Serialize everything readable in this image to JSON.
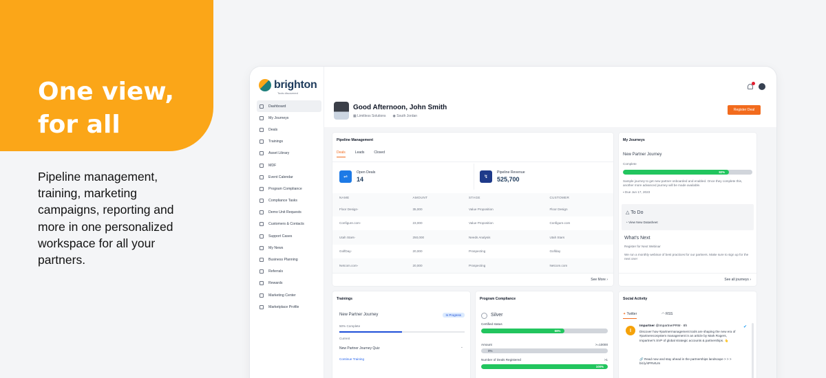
{
  "hero": {
    "title_line1": "One view,",
    "title_line2": "for all",
    "description": "Pipeline management, training, marketing campaigns, reporting and more in one personalized workspace for all your partners."
  },
  "brand": {
    "name": "brighton",
    "tagline": "Tools discovered",
    "accent": "#f26b1d",
    "orange_block": "#fba618"
  },
  "sidebar": {
    "items": [
      {
        "label": "Dashboard",
        "icon": "dashboard-icon"
      },
      {
        "label": "My Journeys",
        "icon": "journeys-icon"
      },
      {
        "label": "Deals",
        "icon": "deals-icon"
      },
      {
        "label": "Trainings",
        "icon": "trainings-icon"
      },
      {
        "label": "Asset Library",
        "icon": "library-icon"
      },
      {
        "label": "MDF",
        "icon": "mdf-icon"
      },
      {
        "label": "Event Calendar",
        "icon": "calendar-icon"
      },
      {
        "label": "Program Compliance",
        "icon": "check-icon"
      },
      {
        "label": "Compliance Tasks",
        "icon": "tasks-icon"
      },
      {
        "label": "Demo Unit Requests",
        "icon": "demo-icon"
      },
      {
        "label": "Customers & Contacts",
        "icon": "contacts-icon"
      },
      {
        "label": "Support Cases",
        "icon": "support-icon"
      },
      {
        "label": "My News",
        "icon": "news-icon"
      },
      {
        "label": "Business Planning",
        "icon": "planning-icon"
      },
      {
        "label": "Referrals",
        "icon": "referrals-icon"
      },
      {
        "label": "Rewards",
        "icon": "rewards-icon"
      },
      {
        "label": "Marketing Center",
        "icon": "marketing-icon"
      },
      {
        "label": "Marketplace Profile",
        "icon": "profile-icon"
      }
    ]
  },
  "header": {
    "greeting": "Good Afternoon, John Smith",
    "company": "Limitless Solutions",
    "location": "South Jordan",
    "register_label": "Register Deal"
  },
  "pipeline": {
    "title": "Pipeline Management",
    "tabs": [
      "Deals",
      "Leads",
      "Closed"
    ],
    "open_deals_label": "Open Deals",
    "open_deals_value": "14",
    "revenue_label": "Pipeline Revenue",
    "revenue_value": "525,700",
    "columns": [
      "NAME",
      "AMOUNT",
      "STAGE",
      "CUSTOMER"
    ],
    "rows": [
      [
        "Floor Design-",
        "35,000",
        "Value Proposition",
        "Floor Design"
      ],
      [
        "Configure.com-",
        "23,000",
        "Value Proposition",
        "Configure.com"
      ],
      [
        "Utah Stars-",
        "250,000",
        "Needs Analysis",
        "Utah Stars"
      ],
      [
        "GolfDay-",
        "20,000",
        "Prospecting",
        "Golfday"
      ],
      [
        "Netcom.com-",
        "20,000",
        "Prospecting",
        "Netcom.com"
      ]
    ],
    "see_more": "See More ›"
  },
  "journeys": {
    "title": "My Journeys",
    "name": "New Partner Journey",
    "status": "Complete",
    "progress": 0.82,
    "progress_label": "82%",
    "description": "Sample journey to get new partner onboarded and enabled. Once they complete this, another more advanced journey will be made available.",
    "due": "Due Jun 17, 2023",
    "todo_title": "To Do",
    "todo_link": "View New Datasheet",
    "next_title": "What's Next",
    "next_sub": "Register for Next Webinar",
    "next_desc": "We run a monthly webinar of best practices for our partners. Make sure to sign up for the next one!",
    "see_all": "See all journeys ›"
  },
  "trainings": {
    "title": "Trainings",
    "course": "New Partner Journey",
    "badge": "In Progress",
    "complete_label": "50% Complete",
    "progress": 0.5,
    "status": "Current",
    "quiz": "New Partner Journey Quiz",
    "continue": "Continue Training"
  },
  "compliance": {
    "title": "Program Compliance",
    "tier": "Silver",
    "certified_label": "Certified status",
    "certified_progress": 0.66,
    "certified_pct": "66%",
    "amount_label": "Amount",
    "amount_target": ">=10000",
    "amount_progress": 0.0,
    "amount_pct": "0%",
    "deals_label": "Number of Deals Registered",
    "deals_target": ">1",
    "deals_progress": 1.0,
    "deals_pct": "100%"
  },
  "social": {
    "title": "Social Activity",
    "tabs": [
      "Twitter",
      "RSS"
    ],
    "author": "Impartner",
    "handle": "@ImpartnerPRM · 8h",
    "body": "Discover how #partnermanagement tools are shaping the new era of #partnerecosystem management in an article by Mark Rogers, Impartner's SVP of global strategic accounts & partnerships. 👆",
    "link": "🔗 Read now and stay ahead in the partnerships landscape > > > bit.ly/4PRvtUm"
  }
}
